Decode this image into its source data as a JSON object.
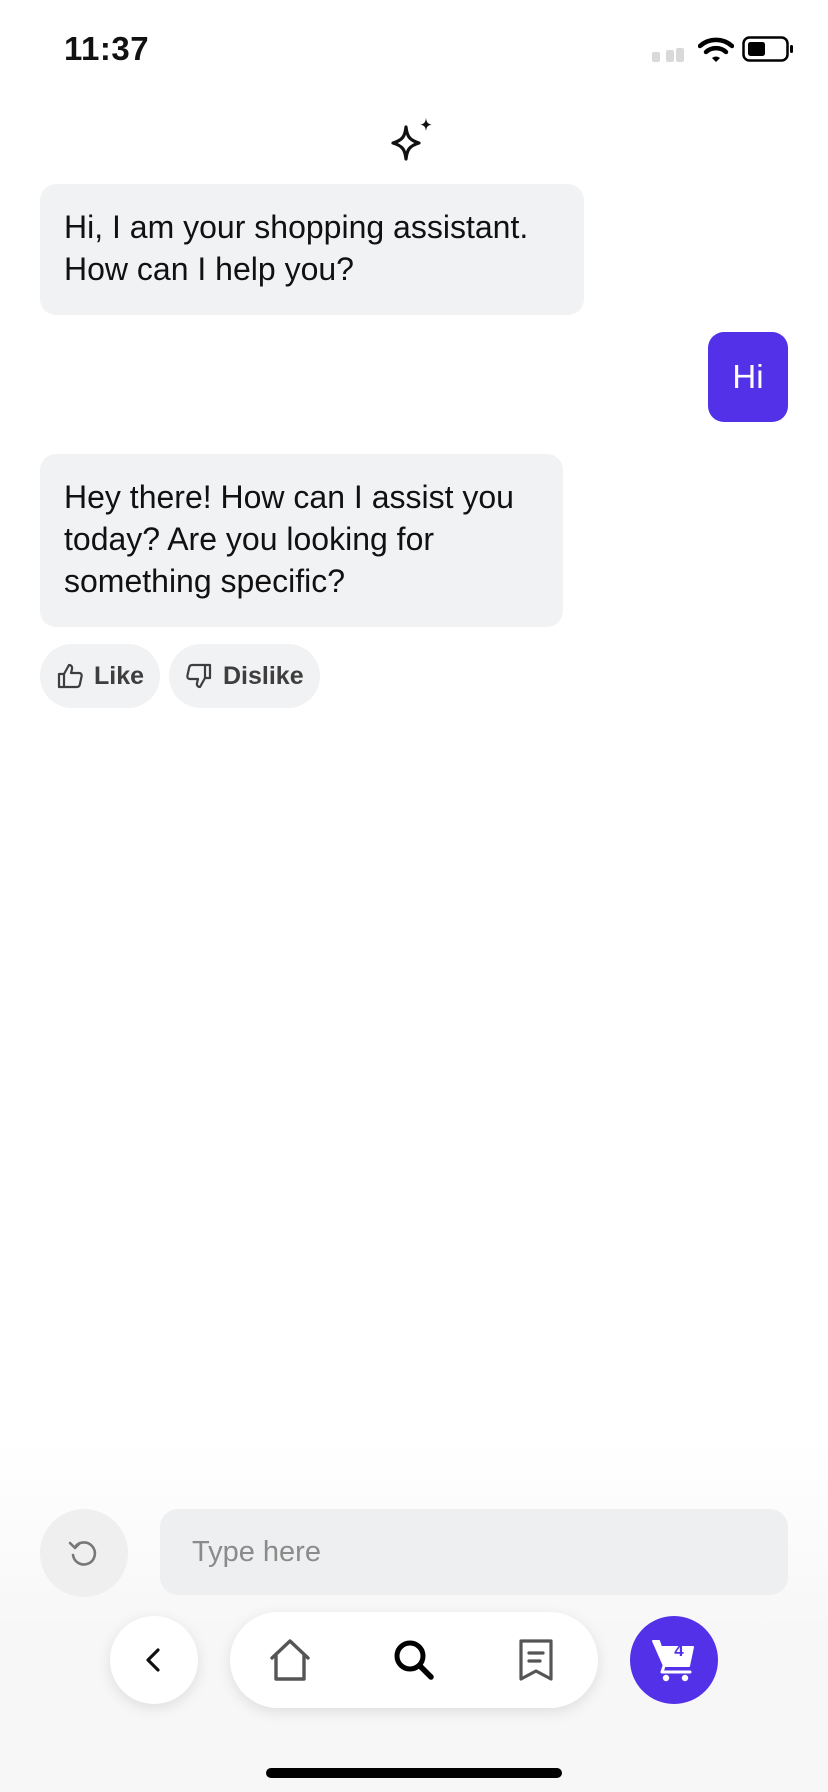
{
  "status_bar": {
    "time": "11:37"
  },
  "header": {
    "icon": "sparkle-icon"
  },
  "messages": [
    {
      "sender": "assistant",
      "text": "Hi, I am your shopping assistant. How can I help you?"
    },
    {
      "sender": "user",
      "text": "Hi"
    },
    {
      "sender": "assistant",
      "text": "Hey there! How can I assist you today? Are you looking for something specific?"
    }
  ],
  "feedback": {
    "like_label": "Like",
    "dislike_label": "Dislike"
  },
  "composer": {
    "placeholder": "Type here"
  },
  "nav": {
    "items": [
      "back-icon",
      "home-icon",
      "search-icon",
      "receipt-icon",
      "cart-icon"
    ],
    "cart_count": "4"
  },
  "colors": {
    "accent": "#5231e8",
    "bubble_bg": "#f1f2f3"
  }
}
